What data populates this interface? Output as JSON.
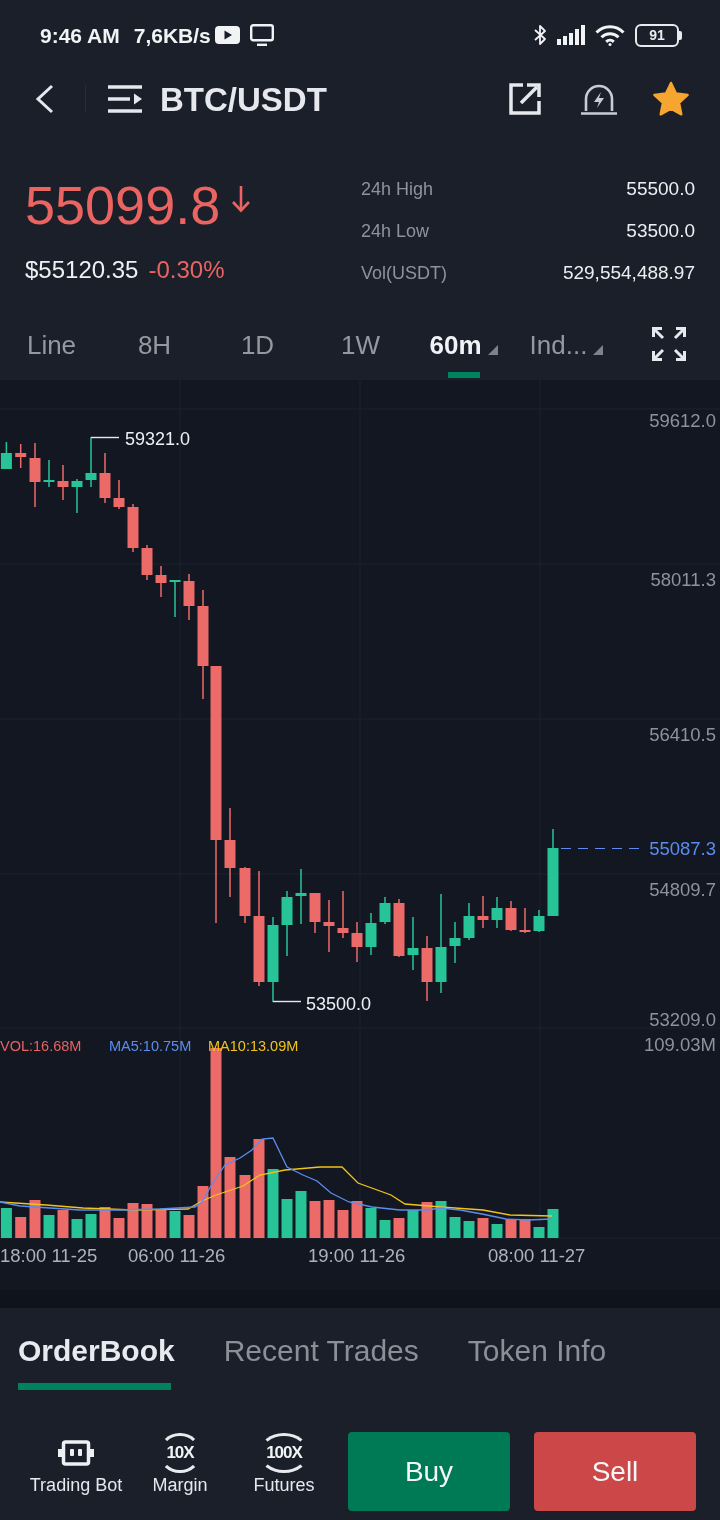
{
  "status_bar": {
    "time": "9:46 AM",
    "net_speed": "7,6KB/s",
    "battery": "91"
  },
  "header": {
    "title": "BTC/USDT",
    "favorite": true
  },
  "ticker": {
    "last_price": "55099.8",
    "price_falling": true,
    "fiat_price": "$55120.35",
    "change": "-0.30%",
    "stats": [
      {
        "label": "24h High",
        "value": "55500.0"
      },
      {
        "label": "24h Low",
        "value": "53500.0"
      },
      {
        "label": "Vol(USDT)",
        "value": "529,554,488.97"
      }
    ]
  },
  "intervals": [
    {
      "label": "Line",
      "selected": false,
      "dropdown": false
    },
    {
      "label": "8H",
      "selected": false,
      "dropdown": false
    },
    {
      "label": "1D",
      "selected": false,
      "dropdown": false
    },
    {
      "label": "1W",
      "selected": false,
      "dropdown": false
    },
    {
      "label": "60m",
      "selected": true,
      "dropdown": true
    },
    {
      "label": "Ind...",
      "selected": false,
      "dropdown": true
    }
  ],
  "chart": {
    "price_axis": [
      "59612.0",
      "58011.3",
      "56410.5",
      "54809.7",
      "53209.0"
    ],
    "high_label": "59321.0",
    "low_label": "53500.0",
    "last_price_label": "55087.3",
    "volume_legend": [
      {
        "label": "VOL:16.68M",
        "color": "#e8625f"
      },
      {
        "label": "MA5:10.75M",
        "color": "#5b8def"
      },
      {
        "label": "MA10:13.09M",
        "color": "#f0c419"
      }
    ],
    "volume_axis": "109.03M",
    "time_axis": [
      "18:00 11-25",
      "06:00 11-26",
      "19:00 11-26",
      "08:00 11-27"
    ]
  },
  "tabs": [
    {
      "label": "OrderBook",
      "selected": true
    },
    {
      "label": "Recent Trades",
      "selected": false
    },
    {
      "label": "Token Info",
      "selected": false
    }
  ],
  "actions": [
    {
      "kind": "bot",
      "label": "Trading Bot"
    },
    {
      "kind": "leverage",
      "badge": "10X",
      "label": "Margin"
    },
    {
      "kind": "leverage",
      "badge": "100X",
      "label": "Futures"
    }
  ],
  "buttons": [
    {
      "kind": "buy",
      "label": "Buy"
    },
    {
      "kind": "sell",
      "label": "Sell"
    }
  ]
}
